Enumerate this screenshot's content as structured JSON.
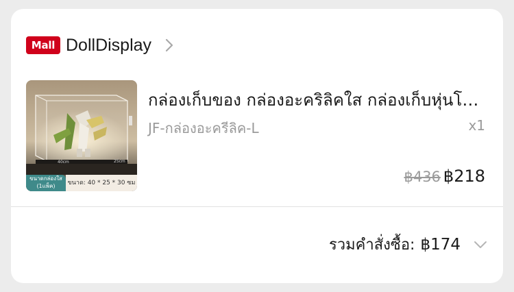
{
  "shop": {
    "badge": "Mall",
    "name": "DollDisplay",
    "chevron_icon": "chevron-right-icon"
  },
  "product": {
    "title": "กล่องเก็บของ กล่องอะคริลิคใส กล่องเก็บหุ่นโมเดล",
    "variant": "JF-กล่องอะครีลิค-L",
    "quantity": "x1",
    "price_original": "฿436",
    "price_current": "฿218",
    "image": {
      "caption_left": "ขนาดกล่องใส (1แพ็ค)",
      "caption_right": "ขนาด: 40 * 25 * 30 ซม"
    }
  },
  "order_total": {
    "label": "รวมคำสั่งซื้อ:",
    "value": "฿174",
    "chevron_icon": "chevron-down-icon"
  },
  "colors": {
    "mall_badge": "#d0011b",
    "muted_text": "#9a9a9a",
    "caption_teal": "#3f8a8a"
  }
}
